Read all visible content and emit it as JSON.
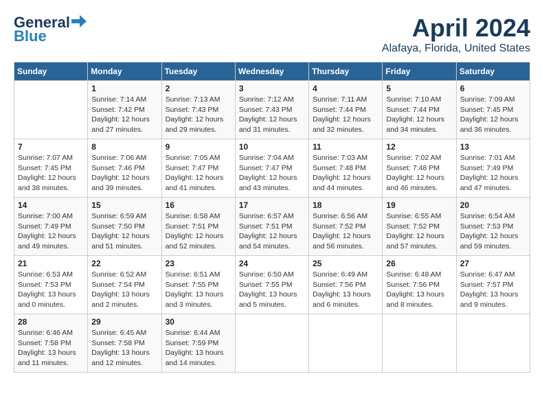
{
  "header": {
    "logo_general": "General",
    "logo_blue": "Blue",
    "title": "April 2024",
    "subtitle": "Alafaya, Florida, United States"
  },
  "calendar": {
    "days_of_week": [
      "Sunday",
      "Monday",
      "Tuesday",
      "Wednesday",
      "Thursday",
      "Friday",
      "Saturday"
    ],
    "weeks": [
      [
        {
          "day": "",
          "info": ""
        },
        {
          "day": "1",
          "info": "Sunrise: 7:14 AM\nSunset: 7:42 PM\nDaylight: 12 hours\nand 27 minutes."
        },
        {
          "day": "2",
          "info": "Sunrise: 7:13 AM\nSunset: 7:43 PM\nDaylight: 12 hours\nand 29 minutes."
        },
        {
          "day": "3",
          "info": "Sunrise: 7:12 AM\nSunset: 7:43 PM\nDaylight: 12 hours\nand 31 minutes."
        },
        {
          "day": "4",
          "info": "Sunrise: 7:11 AM\nSunset: 7:44 PM\nDaylight: 12 hours\nand 32 minutes."
        },
        {
          "day": "5",
          "info": "Sunrise: 7:10 AM\nSunset: 7:44 PM\nDaylight: 12 hours\nand 34 minutes."
        },
        {
          "day": "6",
          "info": "Sunrise: 7:09 AM\nSunset: 7:45 PM\nDaylight: 12 hours\nand 36 minutes."
        }
      ],
      [
        {
          "day": "7",
          "info": "Sunrise: 7:07 AM\nSunset: 7:45 PM\nDaylight: 12 hours\nand 38 minutes."
        },
        {
          "day": "8",
          "info": "Sunrise: 7:06 AM\nSunset: 7:46 PM\nDaylight: 12 hours\nand 39 minutes."
        },
        {
          "day": "9",
          "info": "Sunrise: 7:05 AM\nSunset: 7:47 PM\nDaylight: 12 hours\nand 41 minutes."
        },
        {
          "day": "10",
          "info": "Sunrise: 7:04 AM\nSunset: 7:47 PM\nDaylight: 12 hours\nand 43 minutes."
        },
        {
          "day": "11",
          "info": "Sunrise: 7:03 AM\nSunset: 7:48 PM\nDaylight: 12 hours\nand 44 minutes."
        },
        {
          "day": "12",
          "info": "Sunrise: 7:02 AM\nSunset: 7:48 PM\nDaylight: 12 hours\nand 46 minutes."
        },
        {
          "day": "13",
          "info": "Sunrise: 7:01 AM\nSunset: 7:49 PM\nDaylight: 12 hours\nand 47 minutes."
        }
      ],
      [
        {
          "day": "14",
          "info": "Sunrise: 7:00 AM\nSunset: 7:49 PM\nDaylight: 12 hours\nand 49 minutes."
        },
        {
          "day": "15",
          "info": "Sunrise: 6:59 AM\nSunset: 7:50 PM\nDaylight: 12 hours\nand 51 minutes."
        },
        {
          "day": "16",
          "info": "Sunrise: 6:58 AM\nSunset: 7:51 PM\nDaylight: 12 hours\nand 52 minutes."
        },
        {
          "day": "17",
          "info": "Sunrise: 6:57 AM\nSunset: 7:51 PM\nDaylight: 12 hours\nand 54 minutes."
        },
        {
          "day": "18",
          "info": "Sunrise: 6:56 AM\nSunset: 7:52 PM\nDaylight: 12 hours\nand 56 minutes."
        },
        {
          "day": "19",
          "info": "Sunrise: 6:55 AM\nSunset: 7:52 PM\nDaylight: 12 hours\nand 57 minutes."
        },
        {
          "day": "20",
          "info": "Sunrise: 6:54 AM\nSunset: 7:53 PM\nDaylight: 12 hours\nand 59 minutes."
        }
      ],
      [
        {
          "day": "21",
          "info": "Sunrise: 6:53 AM\nSunset: 7:53 PM\nDaylight: 13 hours\nand 0 minutes."
        },
        {
          "day": "22",
          "info": "Sunrise: 6:52 AM\nSunset: 7:54 PM\nDaylight: 13 hours\nand 2 minutes."
        },
        {
          "day": "23",
          "info": "Sunrise: 6:51 AM\nSunset: 7:55 PM\nDaylight: 13 hours\nand 3 minutes."
        },
        {
          "day": "24",
          "info": "Sunrise: 6:50 AM\nSunset: 7:55 PM\nDaylight: 13 hours\nand 5 minutes."
        },
        {
          "day": "25",
          "info": "Sunrise: 6:49 AM\nSunset: 7:56 PM\nDaylight: 13 hours\nand 6 minutes."
        },
        {
          "day": "26",
          "info": "Sunrise: 6:48 AM\nSunset: 7:56 PM\nDaylight: 13 hours\nand 8 minutes."
        },
        {
          "day": "27",
          "info": "Sunrise: 6:47 AM\nSunset: 7:57 PM\nDaylight: 13 hours\nand 9 minutes."
        }
      ],
      [
        {
          "day": "28",
          "info": "Sunrise: 6:46 AM\nSunset: 7:58 PM\nDaylight: 13 hours\nand 11 minutes."
        },
        {
          "day": "29",
          "info": "Sunrise: 6:45 AM\nSunset: 7:58 PM\nDaylight: 13 hours\nand 12 minutes."
        },
        {
          "day": "30",
          "info": "Sunrise: 6:44 AM\nSunset: 7:59 PM\nDaylight: 13 hours\nand 14 minutes."
        },
        {
          "day": "",
          "info": ""
        },
        {
          "day": "",
          "info": ""
        },
        {
          "day": "",
          "info": ""
        },
        {
          "day": "",
          "info": ""
        }
      ]
    ]
  }
}
